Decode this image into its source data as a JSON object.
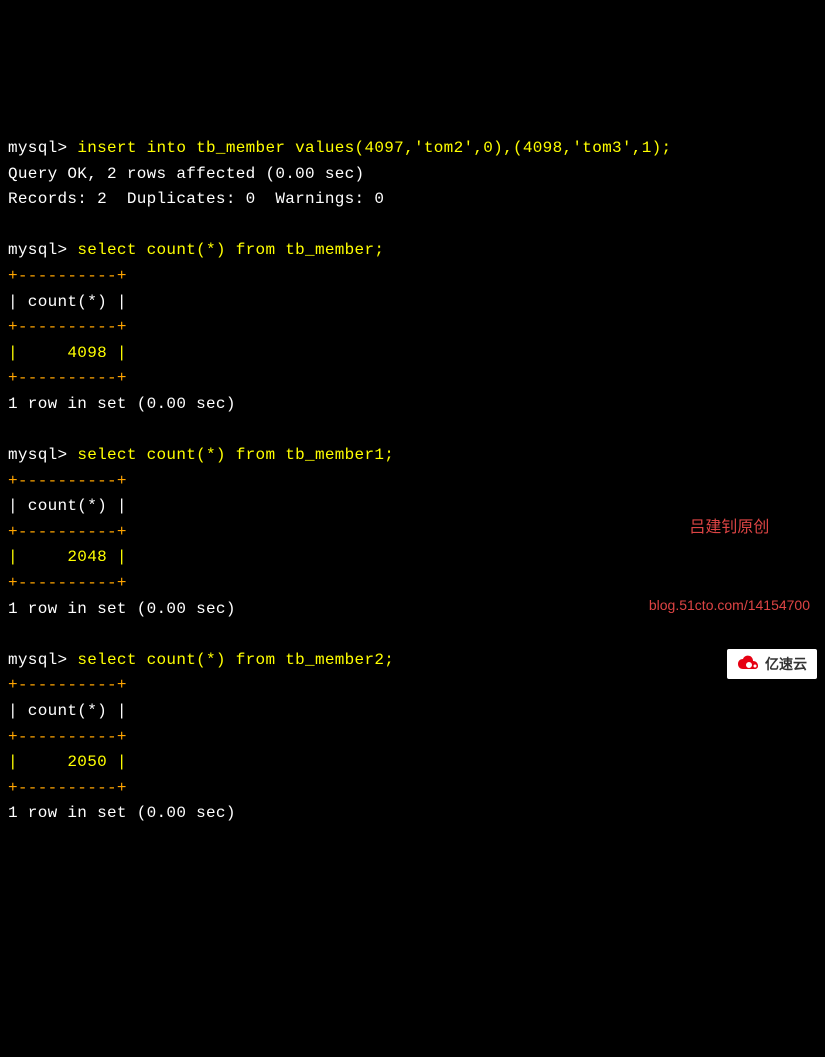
{
  "lines": {
    "prompt": "mysql> ",
    "cmd1": "insert into tb_member values(4097,'tom2',0),(4098,'tom3',1);",
    "result1a": "Query OK, 2 rows affected (0.00 sec)",
    "result1b": "Records: 2  Duplicates: 0  Warnings: 0",
    "cmd2": "select count(*) from tb_member;",
    "border": "+----------+",
    "header": "| count(*) |",
    "value2": "|     4098 |",
    "footer2": "1 row in set (0.00 sec)",
    "cmd3": "select count(*) from tb_member1;",
    "value3": "|     2048 |",
    "footer3": "1 row in set (0.00 sec)",
    "cmd4": "select count(*) from tb_member2;",
    "value4": "|     2050 |",
    "footer4": "1 row in set (0.00 sec)"
  },
  "watermark": {
    "line1": "吕建钊原创",
    "line2": "blog.51cto.com/14154700"
  },
  "logo": {
    "text": "亿速云"
  }
}
